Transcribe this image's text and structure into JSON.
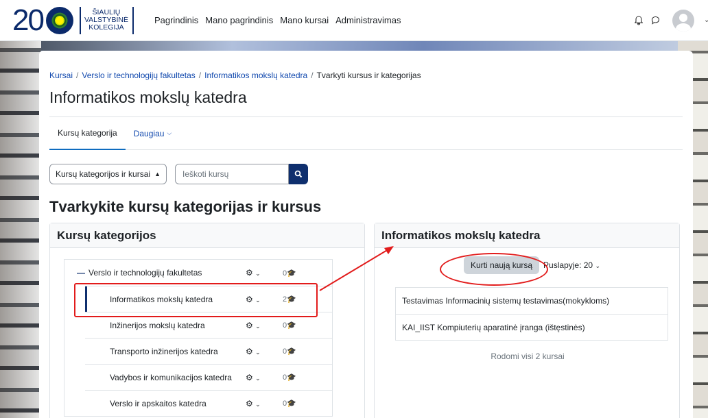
{
  "header": {
    "logo_digits": "20",
    "logo_text": [
      "ŠIAULIŲ",
      "VALSTYBINĖ",
      "KOLEGIJA"
    ],
    "nav": [
      "Pagrindinis",
      "Mano pagrindinis",
      "Mano kursai",
      "Administravimas"
    ],
    "icons": [
      "bell-icon",
      "chat-icon",
      "user-avatar"
    ]
  },
  "breadcrumb": [
    "Kursai",
    "Verslo ir technologijų fakultetas",
    "Informatikos mokslų katedra",
    "Tvarkyti kursus ir kategorijas"
  ],
  "page_title": "Informatikos mokslų katedra",
  "tabs": {
    "category": "Kursų kategorija",
    "more": "Daugiau"
  },
  "filters": {
    "select_value": "Kursų kategorijos ir kursai",
    "search_placeholder": "Ieškoti kursų"
  },
  "section_title": "Tvarkykite kursų kategorijas ir kursus",
  "categories_panel": {
    "title": "Kursų kategorijos",
    "parent": {
      "name": "Verslo ir technologijų fakultetas",
      "count": "0"
    },
    "children": [
      {
        "name": "Informatikos mokslų katedra",
        "count": "2"
      },
      {
        "name": "Inžinerijos mokslų katedra",
        "count": "0"
      },
      {
        "name": "Transporto inžinerijos katedra",
        "count": "0"
      },
      {
        "name": "Vadybos ir komunikacijos katedra",
        "count": "0"
      },
      {
        "name": "Verslo ir apskaitos katedra",
        "count": "0"
      }
    ]
  },
  "courses_panel": {
    "title": "Informatikos mokslų katedra",
    "create_button": "Kurti naują kursą",
    "per_page": "Puslapyje: 20",
    "courses": [
      "Testavimas Informacinių sistemų testavimas(mokykloms)",
      "KAI_IIST Kompiuterių aparatinė įranga (ištęstinės)"
    ],
    "shown": "Rodomi visi 2 kursai"
  },
  "colors": {
    "annotation": "#e21b1b",
    "brand": "#0f2f6e",
    "link": "#0f47ad"
  }
}
